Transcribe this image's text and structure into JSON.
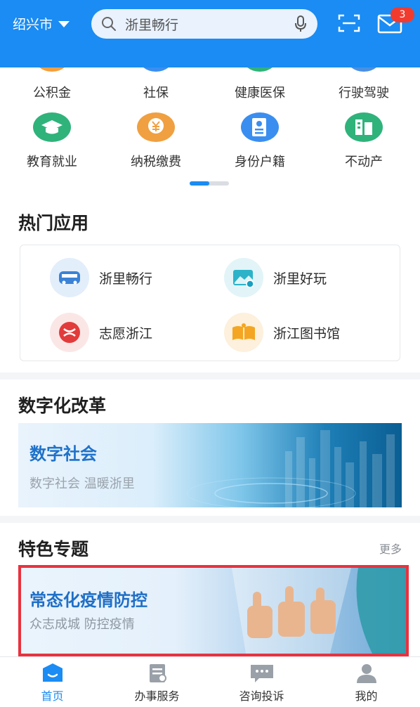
{
  "header": {
    "city": "绍兴市",
    "search_placeholder": "浙里畅行",
    "notification_count": "3",
    "brand_color": "#1a8cf3"
  },
  "categories": [
    {
      "label": "公积金",
      "icon": "housing-fund-icon",
      "color": "#f0a040"
    },
    {
      "label": "社保",
      "icon": "social-security-icon",
      "color": "#3a8ef0"
    },
    {
      "label": "健康医保",
      "icon": "medical-insurance-icon",
      "color": "#2fb37b"
    },
    {
      "label": "行驶驾驶",
      "icon": "driving-icon",
      "color": "#4a90e2"
    },
    {
      "label": "教育就业",
      "icon": "education-icon",
      "color": "#2fb37b"
    },
    {
      "label": "纳税缴费",
      "icon": "tax-icon",
      "color": "#f0a040"
    },
    {
      "label": "身份户籍",
      "icon": "id-card-icon",
      "color": "#3a8ef0"
    },
    {
      "label": "不动产",
      "icon": "real-estate-icon",
      "color": "#2fb37b"
    }
  ],
  "hot_apps": {
    "title": "热门应用",
    "apps": [
      {
        "label": "浙里畅行",
        "icon": "bus-icon"
      },
      {
        "label": "浙里好玩",
        "icon": "scenery-icon"
      },
      {
        "label": "志愿浙江",
        "icon": "volunteer-icon"
      },
      {
        "label": "浙江图书馆",
        "icon": "book-icon"
      }
    ]
  },
  "digital_reform": {
    "title": "数字化改革",
    "banner_title": "数字社会",
    "banner_subtitle": "数字社会 温暖浙里"
  },
  "featured": {
    "title": "特色专题",
    "more_label": "更多",
    "banner_title": "常态化疫情防控",
    "banner_subtitle": "众志成城 防控疫情",
    "highlight_color": "#e8323f"
  },
  "bottom_nav": [
    {
      "label": "首页",
      "icon": "home-icon",
      "active": true
    },
    {
      "label": "办事服务",
      "icon": "service-icon",
      "active": false
    },
    {
      "label": "咨询投诉",
      "icon": "chat-icon",
      "active": false
    },
    {
      "label": "我的",
      "icon": "user-icon",
      "active": false
    }
  ]
}
